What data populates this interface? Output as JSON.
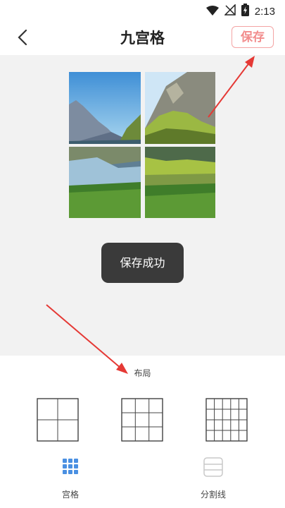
{
  "status_bar": {
    "time": "2:13",
    "icons": [
      "wifi-icon",
      "no-signal-icon",
      "battery-charging-icon"
    ]
  },
  "header": {
    "title": "九宫格",
    "save_label": "保存",
    "back_icon": "chevron-left-icon"
  },
  "toast": {
    "text": "保存成功"
  },
  "panel": {
    "label": "布局",
    "layouts": [
      {
        "name": "2x2",
        "rows": 2,
        "cols": 2
      },
      {
        "name": "3x3",
        "rows": 3,
        "cols": 3
      },
      {
        "name": "4x5",
        "rows": 4,
        "cols": 5
      }
    ]
  },
  "tabs": [
    {
      "label": "宫格",
      "icon": "grid-icon",
      "active": true
    },
    {
      "label": "分割线",
      "icon": "divider-lines-icon",
      "active": false
    }
  ],
  "colors": {
    "accent": "#f28c8c",
    "active_tab": "#4a90e2",
    "arrow": "#e53935",
    "toast_bg": "#3a3a3a"
  }
}
